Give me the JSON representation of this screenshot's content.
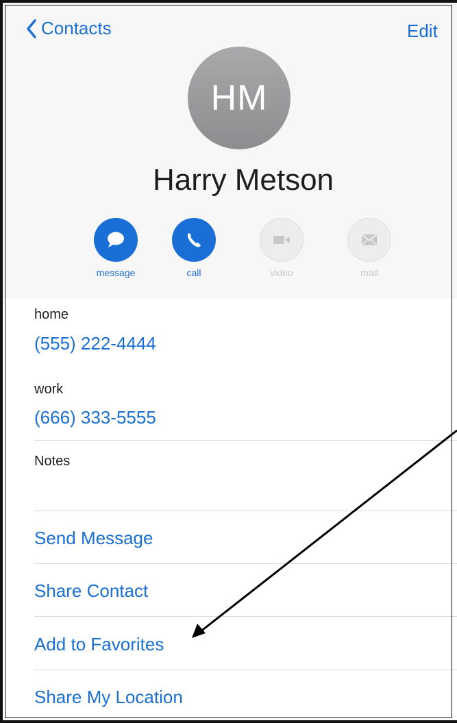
{
  "nav": {
    "back_label": "Contacts",
    "edit_label": "Edit"
  },
  "contact": {
    "initials": "HM",
    "name": "Harry Metson"
  },
  "actions": [
    {
      "label": "message",
      "icon": "message-bubble-icon",
      "enabled": true
    },
    {
      "label": "call",
      "icon": "phone-icon",
      "enabled": true
    },
    {
      "label": "video",
      "icon": "video-camera-icon",
      "enabled": false
    },
    {
      "label": "mail",
      "icon": "envelope-icon",
      "enabled": false
    }
  ],
  "phones": [
    {
      "label": "home",
      "number": "(555) 222-4444"
    },
    {
      "label": "work",
      "number": "(666) 333-5555"
    }
  ],
  "notes_label": "Notes",
  "menu": [
    {
      "label": "Send Message"
    },
    {
      "label": "Share Contact"
    },
    {
      "label": "Add to Favorites"
    },
    {
      "label": "Share My Location"
    }
  ],
  "colors": {
    "accent": "#1a6fd6",
    "header_bg": "#f7f7f7",
    "avatar": "#9b9b9e"
  }
}
